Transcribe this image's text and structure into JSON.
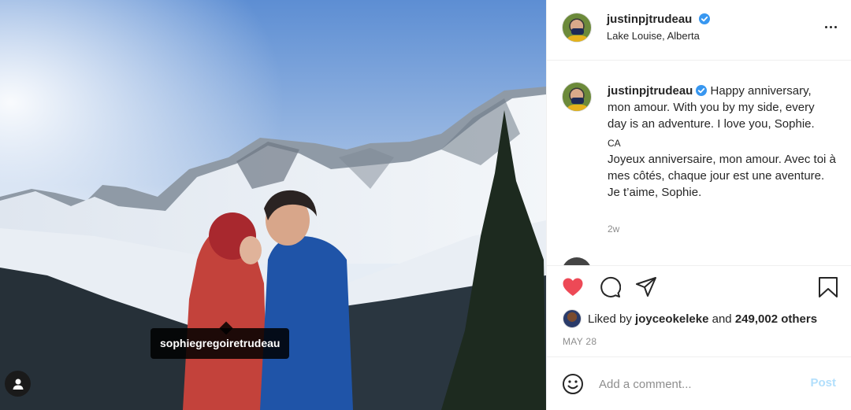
{
  "post": {
    "author": "justinpjtrudeau",
    "location": "Lake Louise, Alberta",
    "caption_en": "Happy anniversary, mon amour. With you by my side, every day is an adventure. I love you, Sophie.",
    "translation_label": "CA",
    "caption_fr": "Joyeux anniversaire, mon amour. Avec toi à mes côtés, chaque jour est une aventure. Je t’aime, Sophie.",
    "time_ago": "2w",
    "likes_user": "joyceokeleke",
    "likes_count": "249,002 others",
    "likes_prefix": "Liked by",
    "likes_and": "and",
    "date": "MAY 28"
  },
  "photo": {
    "tag_label": "sophiegregoiretrudeau"
  },
  "comment_box": {
    "placeholder": "Add a comment...",
    "post_label": "Post"
  },
  "colors": {
    "heart": "#ed4956",
    "verified": "#3897f0",
    "post_disabled": "#b2dffc",
    "muted": "#8e8e8e"
  },
  "icons": [
    "heart-icon",
    "comment-icon",
    "share-icon",
    "bookmark-icon",
    "emoji-icon",
    "more-icon",
    "verified-icon",
    "user-tag-icon"
  ]
}
